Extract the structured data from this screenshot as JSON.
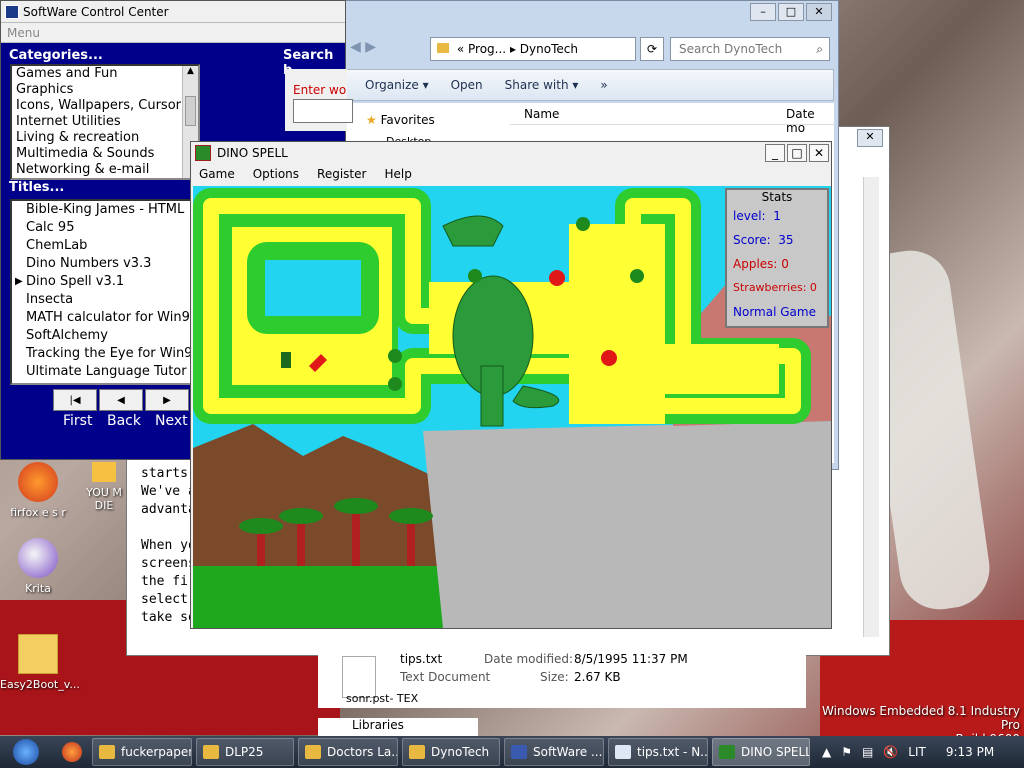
{
  "desktop": {
    "icons": [
      {
        "label": "firfox e s r"
      },
      {
        "label": "YOU M DIE"
      },
      {
        "label": "Krita"
      },
      {
        "label": "Easy2Boot_v..."
      }
    ],
    "watermark_line1": "Windows Embedded 8.1 Industry Pro",
    "watermark_line2": "Build 9600"
  },
  "scc": {
    "title": "SoftWare Control Center",
    "menu": "Menu",
    "categories_label": "Categories...",
    "categories": [
      "Games and Fun",
      "Graphics",
      "Icons, Wallpapers, Cursor",
      "Internet Utilities",
      "Living & recreation",
      "Multimedia & Sounds",
      "Networking & e-mail"
    ],
    "titles_label": "Titles...",
    "titles": [
      "Bible-King James - HTML",
      "Calc 95",
      "ChemLab",
      "Dino Numbers v3.3",
      "Dino Spell v3.1",
      "Insecta",
      "MATH calculator for Win95",
      "SoftAlchemy",
      "Tracking the Eye for Win95",
      "Ultimate Language Tutor"
    ],
    "selected_title_index": 4,
    "search_label": "Search b",
    "search_hint": "Enter wo",
    "nav": {
      "first": "First",
      "back": "Back",
      "next": "Next"
    }
  },
  "explorer": {
    "path_prefix": "«",
    "path_1": "Prog...",
    "path_2": "DynoTech",
    "search_placeholder": "Search DynoTech",
    "toolbar": {
      "organize": "Organize",
      "open": "Open",
      "share": "Share with",
      "more": "»"
    },
    "col_name": "Name",
    "col_date": "Date mo",
    "nav_favorites": "Favorites",
    "nav_desktop": "Desktop",
    "nav_libraries": "Libraries",
    "nav_sonpst": "sonr.pst- TEX",
    "file": {
      "name": "tips.txt",
      "type": "Text Document",
      "modified_label": "Date modified:",
      "modified": "8/5/1995 11:37 PM",
      "size_label": "Size:",
      "size": "2.67 KB"
    }
  },
  "notepad": {
    "lines": [
      "starts",
      "We've a",
      "advanta",
      "",
      "When yo",
      "screens",
      "the fir",
      "select",
      "take so"
    ]
  },
  "dino": {
    "title": "DINO SPELL",
    "menu": [
      "Game",
      "Options",
      "Register",
      "Help"
    ],
    "stats": {
      "header": "Stats",
      "level_label": "level:",
      "level": "1",
      "score_label": "Score:",
      "score": "35",
      "apples_label": "Apples:",
      "apples": "0",
      "strawberries_label": "Strawberries:",
      "strawberries": "0",
      "mode": "Normal Game"
    },
    "colors": {
      "sky": "#22d4f0",
      "path": "#ffff33",
      "hedge": "#2ecc2e",
      "rock": "#b8b8b8",
      "dirt": "#7a4a2a",
      "level_text": "#0000cc",
      "counter_text": "#cc0000"
    }
  },
  "taskbar": {
    "tasks": [
      "fuckerpaper",
      "DLP25",
      "Doctors La...",
      "DynoTech",
      "SoftWare ...",
      "tips.txt - N...",
      "DINO SPELL"
    ],
    "lang": "LIT",
    "time": "9:13 PM"
  }
}
